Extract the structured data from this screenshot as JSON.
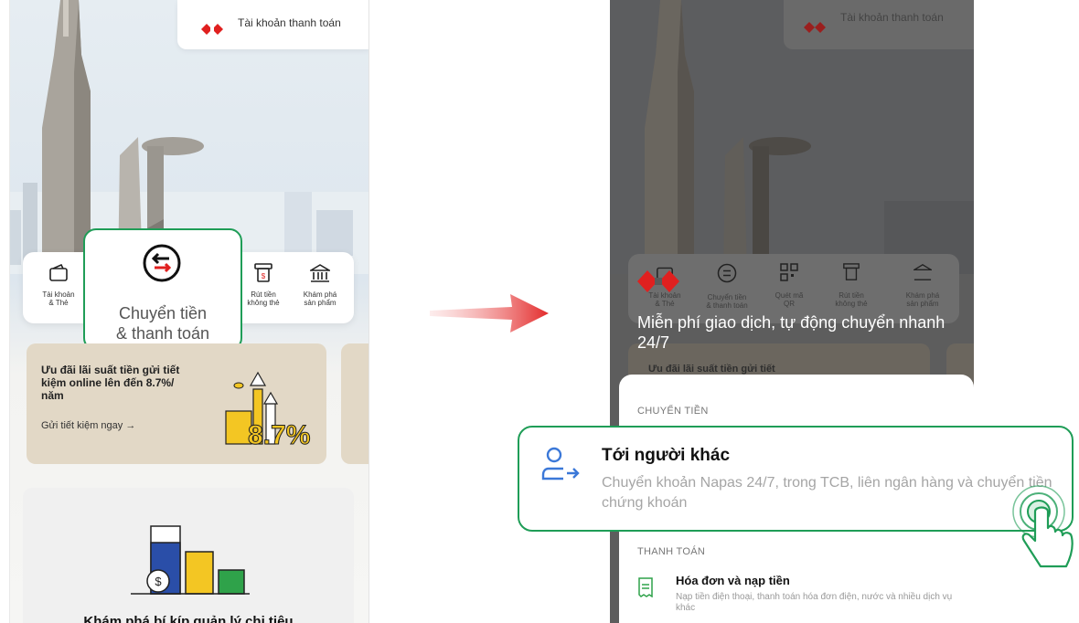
{
  "left_phone": {
    "account_chip_label": "Tài khoản thanh toán",
    "quick_actions": [
      {
        "label": "Tài khoản\n& Thẻ",
        "icon": "wallet-icon"
      },
      {
        "label": "Rút tiền\nkhông thẻ",
        "icon": "atm-card-icon"
      },
      {
        "label": "Khám phá\nsản phẩm",
        "icon": "bank-icon"
      }
    ],
    "zoom_highlight": {
      "label": "Chuyển tiền\n& thanh toán",
      "icon": "transfer-arrows-icon"
    },
    "promo": {
      "title": "Ưu đãi lãi suất tiền gửi tiết kiệm online lên đến 8.7%/ năm",
      "link": "Gửi tiết kiệm ngay →",
      "figure_text": "8.7%"
    },
    "explore_title": "Khám phá bí kíp quản lý chi tiêu"
  },
  "right_phone": {
    "account_chip_label": "Tài khoản thanh toán",
    "quick_actions": [
      {
        "label": "Tài khoản\n& Thẻ",
        "icon": "wallet-icon"
      },
      {
        "label": "Chuyển tiền\n& thanh toán",
        "icon": "transfer-arrows-icon"
      },
      {
        "label": "Quét mã\nQR",
        "icon": "qr-code-icon"
      },
      {
        "label": "Rút tiền\nkhông thẻ",
        "icon": "atm-card-icon"
      },
      {
        "label": "Khám phá\nsản phẩm",
        "icon": "bank-icon"
      }
    ],
    "promo_title": "Ưu đãi lãi suất tiền gửi tiết",
    "overlay_message": "Miễn phí giao dịch, tự động chuyển nhanh 24/7",
    "sheet": {
      "transfer_header": "CHUYỂN TIỀN",
      "payment_header": "THANH TOÁN",
      "bill_item": {
        "title": "Hóa đơn và nạp tiền",
        "subtitle": "Nạp tiền điện thoại, thanh toán hóa đơn điện, nước và nhiều dịch vụ khác"
      }
    }
  },
  "zoom_option": {
    "title": "Tới người khác",
    "subtitle": "Chuyển khoản Napas 24/7, trong TCB, liên ngân hàng và chuyển tiền chứng khoán",
    "icon": "person-transfer-icon"
  },
  "colors": {
    "highlight_green": "#1f9d57",
    "brand_red": "#e0201f",
    "icon_blue": "#3b78d8"
  }
}
